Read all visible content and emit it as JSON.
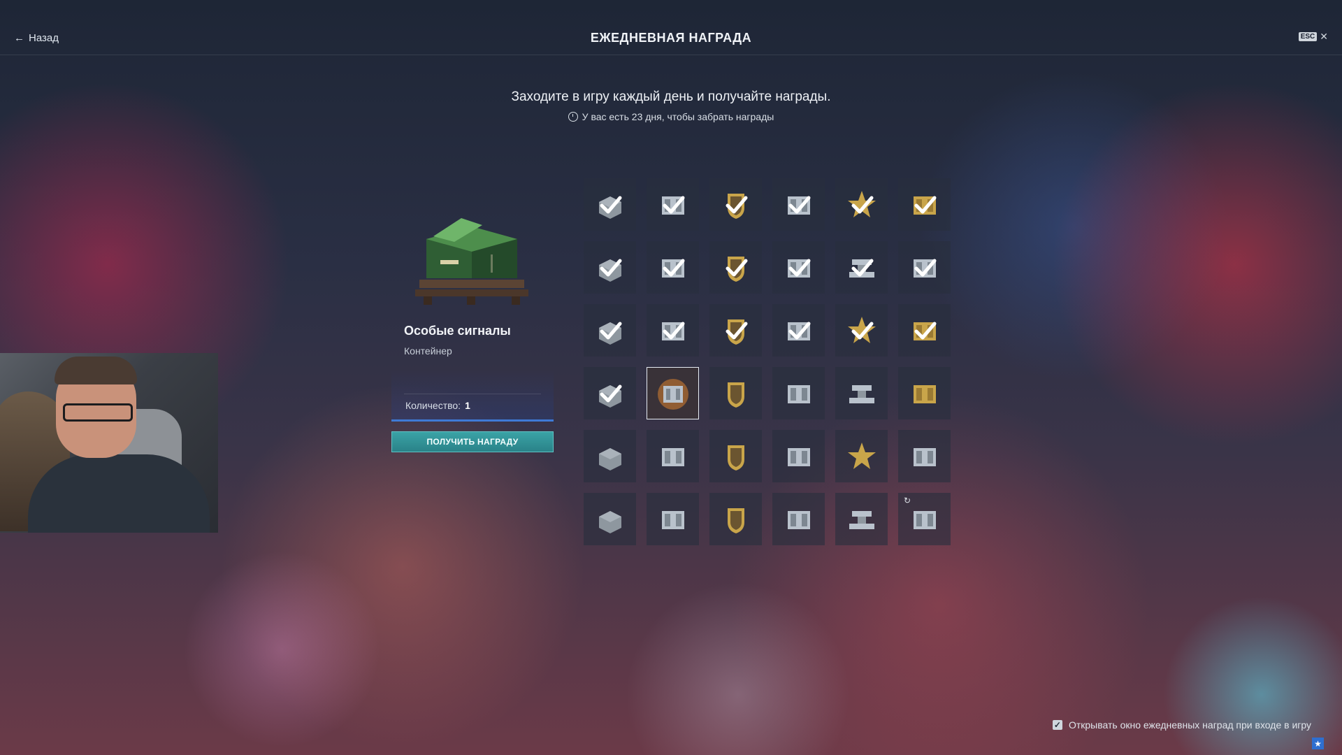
{
  "header": {
    "back_label": "Назад",
    "title": "ЕЖЕДНЕВНАЯ НАГРАДА",
    "esc_key": "ESC",
    "close_glyph": "✕"
  },
  "intro": {
    "subtitle": "Заходите в игру каждый день и получайте награды.",
    "timer_text": "У вас есть 23 дня, чтобы забрать награды"
  },
  "reward": {
    "name": "Особые сигналы",
    "type": "Контейнер",
    "quantity_label": "Количество:",
    "quantity_value": "1",
    "claim_label": "ПОЛУЧИТЬ НАГРАДУ"
  },
  "grid": {
    "cells": [
      {
        "icon": "camouflage-icon",
        "claimed": true
      },
      {
        "icon": "signals-icon",
        "claimed": true
      },
      {
        "icon": "commander-badge-icon",
        "claimed": true
      },
      {
        "icon": "signals-icon",
        "claimed": true
      },
      {
        "icon": "star-icon",
        "claimed": true
      },
      {
        "icon": "gold-container-icon",
        "claimed": true
      },
      {
        "icon": "camouflage-icon",
        "claimed": true
      },
      {
        "icon": "signals-icon",
        "claimed": true
      },
      {
        "icon": "commander-badge-icon",
        "claimed": true
      },
      {
        "icon": "signals-icon",
        "claimed": true
      },
      {
        "icon": "steel-icon",
        "claimed": true
      },
      {
        "icon": "signals-icon",
        "claimed": true
      },
      {
        "icon": "camouflage-icon",
        "claimed": true
      },
      {
        "icon": "signals-icon",
        "claimed": true
      },
      {
        "icon": "commander-badge-icon",
        "claimed": true
      },
      {
        "icon": "signals-icon",
        "claimed": true
      },
      {
        "icon": "star-icon",
        "claimed": true
      },
      {
        "icon": "gold-container-icon",
        "claimed": true
      },
      {
        "icon": "camouflage-icon",
        "claimed": true
      },
      {
        "icon": "special-signals-container-icon",
        "claimed": false,
        "selected": true
      },
      {
        "icon": "commander-badge-icon",
        "claimed": false
      },
      {
        "icon": "signals-container-icon",
        "claimed": false
      },
      {
        "icon": "steel-icon",
        "claimed": false
      },
      {
        "icon": "gold-container-icon",
        "claimed": false
      },
      {
        "icon": "camouflage-icon",
        "claimed": false
      },
      {
        "icon": "signals-container-icon",
        "claimed": false
      },
      {
        "icon": "commander-badge-icon",
        "claimed": false
      },
      {
        "icon": "signals-container-icon",
        "claimed": false
      },
      {
        "icon": "star-icon",
        "claimed": false
      },
      {
        "icon": "signals-container-icon",
        "claimed": false
      },
      {
        "icon": "camouflage-icon",
        "claimed": false
      },
      {
        "icon": "signals-container-icon",
        "claimed": false
      },
      {
        "icon": "commander-badge-icon",
        "claimed": false
      },
      {
        "icon": "signals-container-icon",
        "claimed": false
      },
      {
        "icon": "steel-icon",
        "claimed": false
      },
      {
        "icon": "signals-container-icon",
        "claimed": false,
        "loading": true
      }
    ]
  },
  "footer": {
    "auto_open_label": "Открывать окно ежедневных наград при входе в игру",
    "auto_open_checked": true
  },
  "colors": {
    "accent_teal": "#3aa3a6",
    "progress_blue": "#3f7ad6",
    "gold": "#c9a54a",
    "silver": "#b9c2cc"
  }
}
